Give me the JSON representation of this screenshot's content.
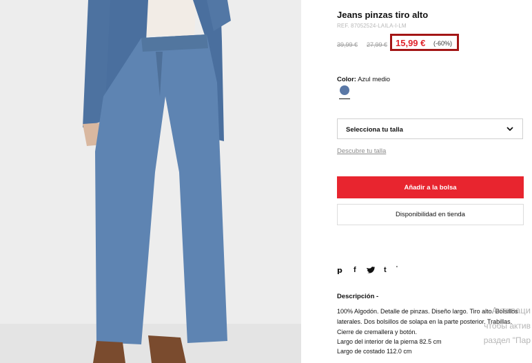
{
  "product": {
    "title": "Jeans pinzas tiro alto",
    "ref": "REF. 87052524-LAILA-I-LM",
    "original_price": "39,99 €",
    "previous_price": "27,99 €",
    "current_price": "15,99 €",
    "discount": "(-60%)"
  },
  "color": {
    "label": "Color:",
    "value": "Azul medio",
    "swatch_hex": "#5a78a6"
  },
  "size": {
    "select_label": "Selecciona tu talla",
    "guide_link": "Descubre tu talla"
  },
  "actions": {
    "add_to_bag": "Añadir a la bolsa",
    "store_availability": "Disponibilidad en tienda"
  },
  "share_icons": [
    "pinterest-icon",
    "facebook-icon",
    "twitter-icon",
    "tumblr-icon",
    "more-icon"
  ],
  "description": {
    "title": "Descripción",
    "text": "100% Algodón. Detalle de pinzas. Diseño largo. Tiro alto. Bolsillos laterales. Dos bolsillos de solapa en la parte posterior. Trabillas. Cierre de cremallera y botón.",
    "inseam": "Largo del interior de la pierna 82.5 cm",
    "side_length": "Largo de costado 112.0 cm"
  },
  "os_watermark": {
    "line1": "Активаци",
    "line2": "чтобы актив",
    "line3": "раздел \"Пар"
  },
  "colors": {
    "accent_red": "#e8252f",
    "highlight_border": "#a31515"
  }
}
